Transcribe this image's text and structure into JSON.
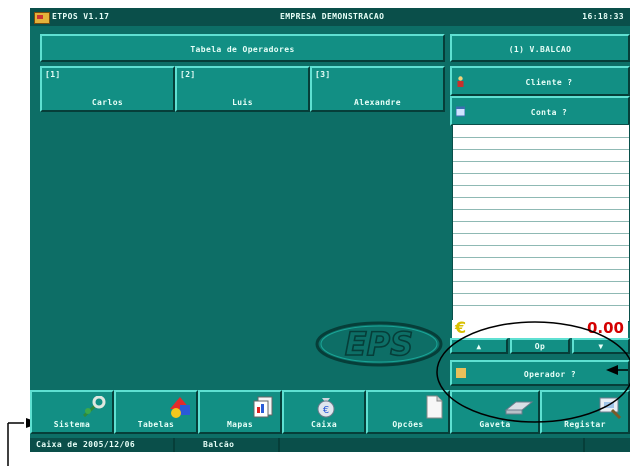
{
  "titlebar": {
    "app_name": "ETPOS V1.17",
    "company": "EMPRESA DEMONSTRACAO",
    "clock": "16:18:33"
  },
  "operators_panel": {
    "title": "Tabela de Operadores",
    "operators": [
      {
        "num": "[1]",
        "name": "Carlos"
      },
      {
        "num": "[2]",
        "name": "Luis"
      },
      {
        "num": "[3]",
        "name": "Alexandre"
      }
    ]
  },
  "right_panel": {
    "mode_label": "(1) V.BALCAO",
    "client_label": "Cliente ?",
    "account_label": "Conta ?",
    "currency_symbol": "€",
    "total": "0.00",
    "nav_up": "▲",
    "nav_op": "Op",
    "nav_down": "▼",
    "operator_label": "Operador ?"
  },
  "logo_text": "EPS",
  "menu": {
    "items": [
      {
        "label": "Sistema",
        "icon": "wrench-icon"
      },
      {
        "label": "Tabelas",
        "icon": "shapes-icon"
      },
      {
        "label": "Mapas",
        "icon": "report-icon"
      },
      {
        "label": "Caixa",
        "icon": "money-bag-icon"
      },
      {
        "label": "Opcões",
        "icon": "document-icon"
      }
    ],
    "right_items": [
      {
        "label": "Gaveta",
        "icon": "drawer-icon"
      },
      {
        "label": "Registar",
        "icon": "register-icon"
      }
    ]
  },
  "statusbar": {
    "caixa": "Caixa de 2005/12/06",
    "location": "Balcão"
  },
  "colors": {
    "background": "#0d6e66",
    "button": "#128f84",
    "dark": "#0a4f4a",
    "total_value": "#d40000",
    "currency": "#d8c000"
  }
}
